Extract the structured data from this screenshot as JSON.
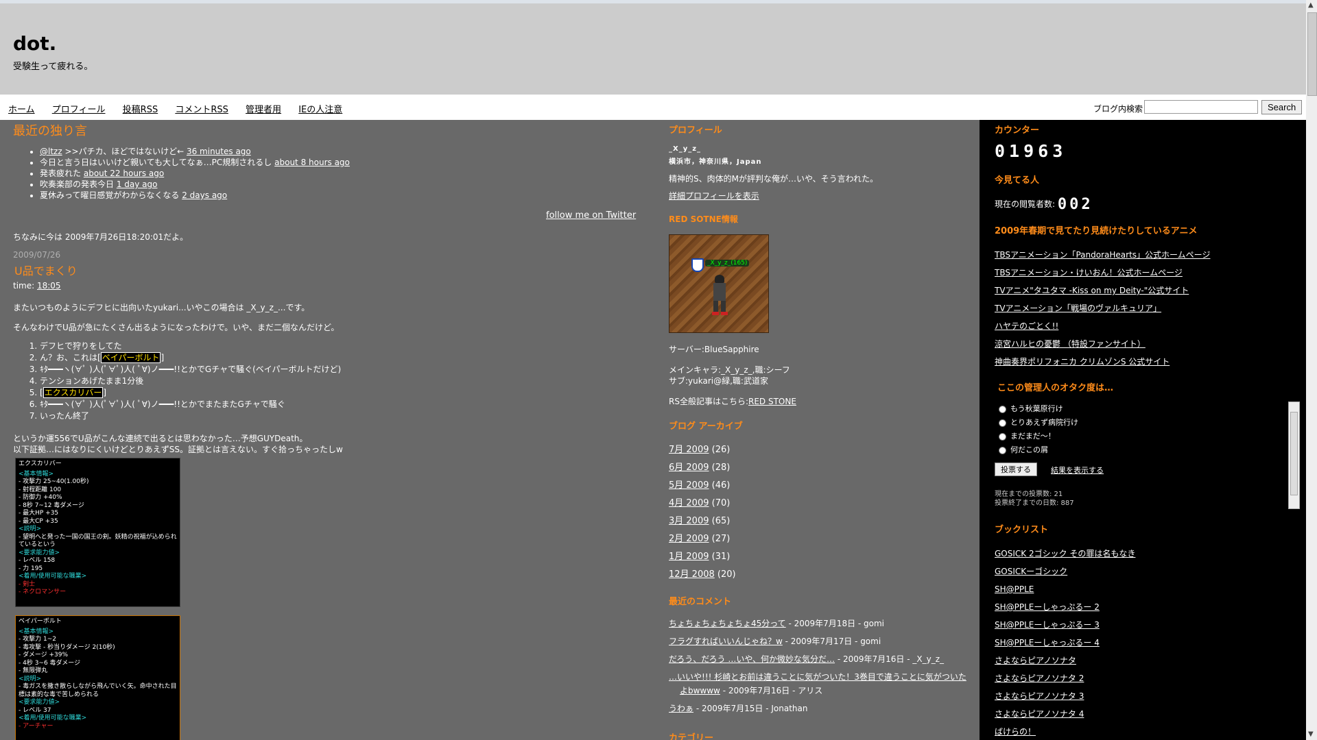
{
  "site": {
    "title": "dot.",
    "description": "受験生って疲れる。"
  },
  "nav": {
    "items": [
      "ホーム",
      "プロフィール",
      "投稿RSS",
      "コメントRSS",
      "管理者用",
      "IEの人注意"
    ]
  },
  "search": {
    "label": "ブログ内検索",
    "value": "",
    "button": "Search"
  },
  "main": {
    "twitter_heading": "最近の独り言",
    "tweets": [
      {
        "prefix": "",
        "user": "@ltzz",
        "text": " >>パチカ、ほどではないけど←",
        "time": "36 minutes ago"
      },
      {
        "prefix": "",
        "user": "",
        "text": "今日と言う日はいいけど親いても大してなぁ…PC規制されるし",
        "time": "about 8 hours ago"
      },
      {
        "prefix": "",
        "user": "",
        "text": "発表疲れた",
        "time": "about 22 hours ago"
      },
      {
        "prefix": "",
        "user": "",
        "text": "吹奏楽部の発表今日",
        "time": "1 day ago"
      },
      {
        "prefix": "",
        "user": "",
        "text": "夏休みって曜日感覚がわからなくなる",
        "time": "2 days ago"
      }
    ],
    "follow_link": "follow me on Twitter",
    "now_text": "ちなみに今は 2009年7月26日18:20:01だよ。",
    "post": {
      "date": "2009/07/26",
      "title": "U品でまくり",
      "time_label": "time:",
      "time": "18:05",
      "para1": "またいつものようにデフヒに出向いたyukari...いやこの場合は _X_y_z_...です。",
      "para2": "そんなわけでU品が急にたくさん出るようになったわけで。いや、まだ二個なんだけど。",
      "list": [
        {
          "text": "デフヒで狩りをしてた",
          "hl": "",
          "after": ""
        },
        {
          "text": "ん？お、これは[",
          "hl": "ベイパーボルト",
          "after": "]"
        },
        {
          "text": "ｷﾀ━━━ヽ(∀ﾟ )人(ﾟ∀ﾟ)人( ﾟ∀)ノ━━━!!とかでGチャで騒ぐ(ベイパーボルトだけど)",
          "hl": "",
          "after": ""
        },
        {
          "text": "テンションあげたまま1分後",
          "hl": "",
          "after": ""
        },
        {
          "text": "[",
          "hl": "エクスカリバー",
          "after": "]"
        },
        {
          "text": "ｷﾀ━━━ヽ(∀ﾟ )人(ﾟ∀ﾟ)人( ﾟ∀)ノ━━━!!とかでまたまたGチャで騒ぐ",
          "hl": "",
          "after": ""
        },
        {
          "text": "いったん終了",
          "hl": "",
          "after": ""
        }
      ],
      "para3": "というか運556でU品がこんな連続で出るとは思わなかった…予想GUYDeath。",
      "para4": "以下証拠…にはなりにくいけどとりあえずSS。証拠とは言えない。すぐ拾っちゃったしw"
    },
    "item1": {
      "name": "エクスカリバー",
      "sections": [
        {
          "head": "<基本情報>",
          "lines": [
            "- 攻撃力 25~40(1.00秒)",
            "- 射程距離 100",
            "- 防御力 +40%",
            "- 8秒 7~12 毒ダメージ",
            "- 最大HP +35",
            "- 最大CP +35"
          ]
        },
        {
          "head": "<説明>",
          "lines": [
            "- 望明へと発った一国の国王の剣。妖精の祝福が込められているという"
          ]
        },
        {
          "head": "<要求能力値>",
          "lines": [
            "- レベル 158",
            "- 力 195"
          ]
        },
        {
          "head": "<着用/使用可能な職業>",
          "lines": [
            "- 剣士",
            "- ネクロマンサー"
          ]
        }
      ]
    },
    "item2": {
      "name": "ベイパーボルト",
      "sections": [
        {
          "head": "<基本情報>",
          "lines": [
            "- 攻撃力 1~2",
            "- 毒攻撃 - 秒当りダメージ 2(10秒)",
            "- ダメージ +39%",
            "- 4秒 3~6 毒ダメージ",
            "- 無限弾丸"
          ]
        },
        {
          "head": "<説明>",
          "lines": [
            "- 毒ガスを撒き散らしながら飛んでいく矢。命中された目標は素的な毒で苦しめられる"
          ]
        },
        {
          "head": "<要求能力値>",
          "lines": [
            "- レベル 37"
          ]
        },
        {
          "head": "<着用/使用可能な職業>",
          "lines": [
            "- アーチャー"
          ]
        }
      ]
    }
  },
  "sidebar1": {
    "profile_heading": "プロフィール",
    "profile_name": "_X_y_z_",
    "profile_location": "横浜市，神奈川県，Japan",
    "profile_desc": "精神的S、肉体的Mが評判な俺が…いや、そう言われた。",
    "profile_link": "詳細プロフィールを表示",
    "rs_heading": "RED SOTNE情報",
    "rs_char_label": "_X_y_z_(165)",
    "rs_server": "サーバー:BlueSapphire",
    "rs_main": "メインキャラ:_X_y_z_,職:シーフ",
    "rs_sub": "サブ:yukari@緑,職:武道家",
    "rs_all_prefix": "RS全般記事はこちら:",
    "rs_all_link": "RED STONE",
    "archive_heading": "ブログ アーカイブ",
    "archive": [
      {
        "label": "7月 2009",
        "count": "(26)"
      },
      {
        "label": "6月 2009",
        "count": "(28)"
      },
      {
        "label": "5月 2009",
        "count": "(46)"
      },
      {
        "label": "4月 2009",
        "count": "(70)"
      },
      {
        "label": "3月 2009",
        "count": "(65)"
      },
      {
        "label": "2月 2009",
        "count": "(27)"
      },
      {
        "label": "1月 2009",
        "count": "(31)"
      },
      {
        "label": "12月 2008",
        "count": "(20)"
      }
    ],
    "comments_heading": "最近のコメント",
    "comments": [
      {
        "link": "ちょちょちょちょちょ45分って",
        "meta": " - 2009年7月18日 - gomi"
      },
      {
        "link": "フラグすればいいんじゃね？w",
        "meta": " - 2009年7月17日 - gomi"
      },
      {
        "link": "だろう、だろう …いや、何か微妙な気分だ…",
        "meta": " - 2009年7月16日 - _X_y_z_"
      },
      {
        "link": "…いいや!!! 杉崎とお前は違うことに気がついた！3巻目で違うことに気がついたよbwwww",
        "meta": " - 2009年7月16日 - アリス"
      },
      {
        "link": "うわぁ",
        "meta": " - 2009年7月15日 - Jonathan"
      }
    ],
    "category_heading": "カテゴリー"
  },
  "sidebar2": {
    "counter_heading": "カウンター",
    "counter_value": "01963",
    "viewers_heading": "今見てる人",
    "viewers_label": "現在の閲覧者数:",
    "viewers_value": "002",
    "anime_heading": "2009年春期で見てたり見続けたりしているアニメ",
    "anime": [
      "TBSアニメーション「PandoraHearts」公式ホームページ",
      "TBSアニメーション・けいおん！公式ホームページ",
      "TVアニメ\"タユタマ -Kiss on my Deity-\"公式サイト",
      "TVアニメーション「戦場のヴァルキュリア」",
      "ハヤテのごとく!!",
      "涼宮ハルヒの憂鬱 （特設ファンサイト）",
      "神曲奏界ポリフォニカ クリムゾンS 公式サイト"
    ],
    "poll_heading": "ここの管理人のオタク度は…",
    "poll_options": [
      "もう秋葉原行け",
      "とりあえず病院行け",
      "まだまだ～！",
      "何だこの屑"
    ],
    "poll_vote": "投票する",
    "poll_results": "結果を表示する",
    "poll_total": "現在までの投票数: 21",
    "poll_days": "投票終了までの日数: 887",
    "books_heading": "ブックリスト",
    "books": [
      "GOSICK 2ゴシック その罪は名もなき",
      "GOSICKーゴシック",
      "SH@PPLE",
      "SH@PPLEーしゃっぷるー 2",
      "SH@PPLEーしゃっぷるー 3",
      "SH@PPLEーしゃっぷるー 4",
      "さよならピアノソナタ",
      "さよならピアノソナタ 2",
      "さよならピアノソナタ 3",
      "さよならピアノソナタ 4",
      "ばけらの！"
    ]
  }
}
